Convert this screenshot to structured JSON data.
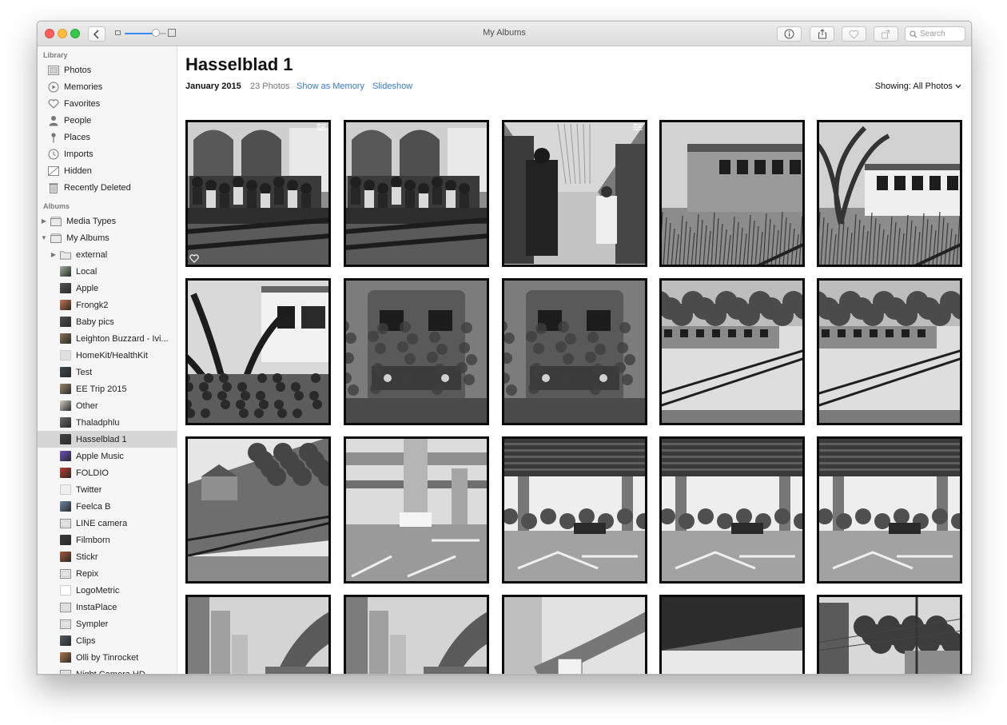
{
  "window": {
    "title": "My Albums"
  },
  "toolbar": {
    "search_placeholder": "Search"
  },
  "sidebar": {
    "library_header": "Library",
    "library": [
      {
        "label": "Photos",
        "icon": "photos-icon"
      },
      {
        "label": "Memories",
        "icon": "memories-icon"
      },
      {
        "label": "Favorites",
        "icon": "heart-icon"
      },
      {
        "label": "People",
        "icon": "person-icon"
      },
      {
        "label": "Places",
        "icon": "pin-icon"
      },
      {
        "label": "Imports",
        "icon": "clock-icon"
      },
      {
        "label": "Hidden",
        "icon": "hidden-icon"
      },
      {
        "label": "Recently Deleted",
        "icon": "trash-icon"
      }
    ],
    "albums_header": "Albums",
    "albums": [
      {
        "label": "Media Types",
        "disclosure": "▶",
        "icon": "album-stack-icon"
      },
      {
        "label": "My Albums",
        "disclosure": "▼",
        "icon": "album-stack-icon"
      },
      {
        "label": "external",
        "disclosure": "▶",
        "icon": "folder-icon"
      },
      {
        "label": "Local",
        "icon": "album-thumb-icon",
        "color": "#9fb49a"
      },
      {
        "label": "Apple",
        "icon": "album-thumb-icon",
        "color": "#555555"
      },
      {
        "label": "Frongk2",
        "icon": "album-thumb-icon",
        "color": "#c8734c"
      },
      {
        "label": "Baby pics",
        "icon": "album-thumb-icon",
        "color": "#4e4e4e"
      },
      {
        "label": "Leighton Buzzard - Ivi...",
        "icon": "album-thumb-icon",
        "color": "#8c7355"
      },
      {
        "label": "HomeKit/HealthKit",
        "icon": "album-thumb-icon",
        "color": "#e0e0e0"
      },
      {
        "label": "Test",
        "icon": "album-thumb-icon",
        "color": "#3b4a4a"
      },
      {
        "label": "EE Trip 2015",
        "icon": "album-thumb-icon",
        "color": "#9a8a6a"
      },
      {
        "label": "Other",
        "icon": "album-thumb-icon",
        "color": "#d4cfc6"
      },
      {
        "label": "Thaladphlu",
        "icon": "album-thumb-icon",
        "color": "#6a6a6a"
      },
      {
        "label": "Hasselblad 1",
        "icon": "album-thumb-icon",
        "color": "#444444",
        "selected": true
      },
      {
        "label": "Apple Music",
        "icon": "album-thumb-icon",
        "color": "#6b4fc4"
      },
      {
        "label": "FOLDIO",
        "icon": "album-thumb-icon",
        "color": "#c13a2a"
      },
      {
        "label": "Twitter",
        "icon": "album-thumb-icon",
        "color": "#efefef"
      },
      {
        "label": "Feelca B",
        "icon": "album-thumb-icon",
        "color": "#6f88a6"
      },
      {
        "label": "LINE camera",
        "icon": "album-icon"
      },
      {
        "label": "Filmborn",
        "icon": "album-thumb-icon",
        "color": "#3a3a3a"
      },
      {
        "label": "Stickr",
        "icon": "album-thumb-icon",
        "color": "#a25b36"
      },
      {
        "label": "Repix",
        "icon": "album-icon"
      },
      {
        "label": "LogoMetric",
        "icon": "album-thumb-icon",
        "color": "#ffffff"
      },
      {
        "label": "InstaPlace",
        "icon": "album-icon"
      },
      {
        "label": "Sympler",
        "icon": "album-icon"
      },
      {
        "label": "Clips",
        "icon": "album-thumb-icon",
        "color": "#505a60"
      },
      {
        "label": "Olli by Tinrocket",
        "icon": "album-thumb-icon",
        "color": "#b07a4a"
      },
      {
        "label": "Night Camera HD",
        "icon": "album-icon"
      }
    ]
  },
  "main": {
    "title": "Hasselblad 1",
    "date": "January 2015",
    "count": "23 Photos",
    "show_as_memory": "Show as Memory",
    "slideshow": "Slideshow",
    "showing": "Showing: All Photos",
    "photos": [
      {
        "scene": "platform",
        "favorite": true,
        "badge": true
      },
      {
        "scene": "platform",
        "favorite": false,
        "badge": false
      },
      {
        "scene": "train-interior",
        "favorite": false,
        "badge": true
      },
      {
        "scene": "train-car",
        "favorite": false,
        "badge": false
      },
      {
        "scene": "train-car-palm",
        "favorite": false,
        "badge": false
      },
      {
        "scene": "train-palm",
        "favorite": false,
        "badge": false
      },
      {
        "scene": "train-front",
        "favorite": false,
        "badge": false
      },
      {
        "scene": "train-front",
        "favorite": false,
        "badge": false
      },
      {
        "scene": "tracks-train",
        "favorite": false,
        "badge": false
      },
      {
        "scene": "tracks-train",
        "favorite": false,
        "badge": false
      },
      {
        "scene": "tracks",
        "favorite": false,
        "badge": false
      },
      {
        "scene": "street-overpass",
        "favorite": false,
        "badge": false
      },
      {
        "scene": "overpass-street",
        "favorite": false,
        "badge": false
      },
      {
        "scene": "overpass-street",
        "favorite": false,
        "badge": false
      },
      {
        "scene": "overpass-street",
        "favorite": false,
        "badge": false
      },
      {
        "scene": "city-highway",
        "favorite": false,
        "badge": false
      },
      {
        "scene": "city-highway",
        "favorite": false,
        "badge": false
      },
      {
        "scene": "skytrain",
        "favorite": false,
        "badge": false
      },
      {
        "scene": "market",
        "favorite": false,
        "badge": false
      },
      {
        "scene": "street-houses",
        "favorite": false,
        "badge": false
      }
    ]
  }
}
